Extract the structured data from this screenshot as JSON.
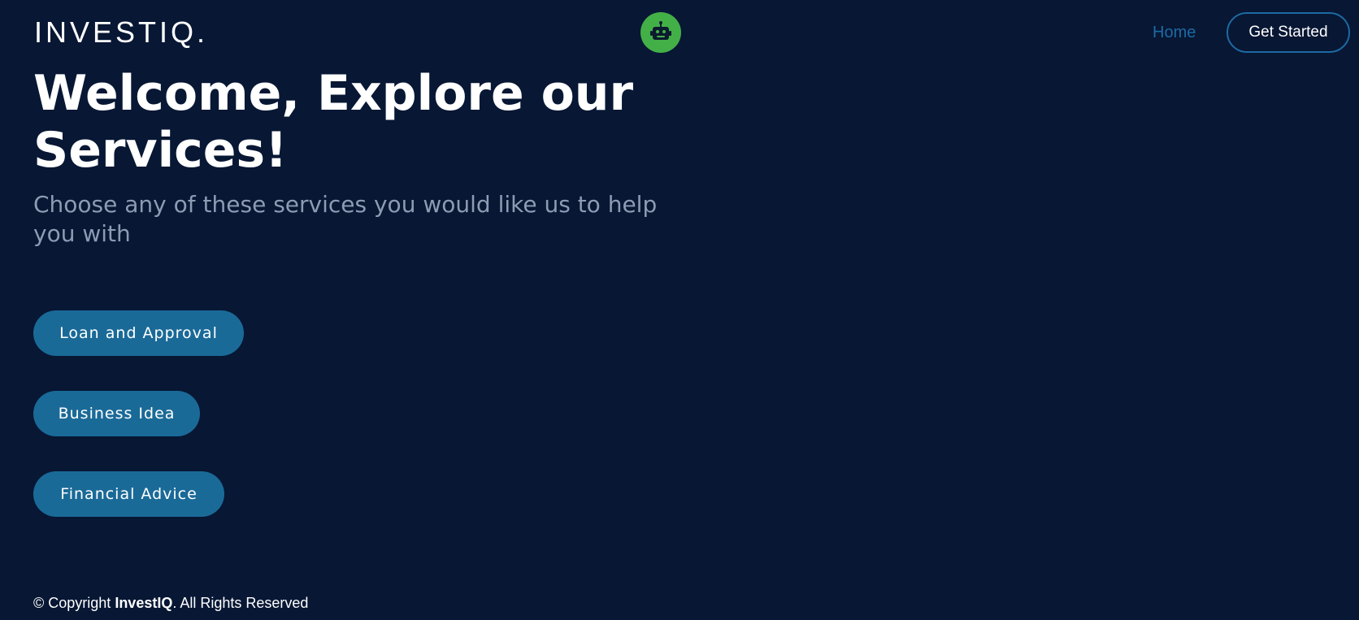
{
  "header": {
    "logo_text": "INVESTIQ",
    "logo_dot": ".",
    "bot_icon": "robot-icon",
    "nav_home": "Home",
    "get_started": "Get Started"
  },
  "hero": {
    "title": "Welcome, Explore our Services!",
    "subtitle": "Choose any of these services you would like us to help you with"
  },
  "services": [
    {
      "label": "Loan and Approval"
    },
    {
      "label": "Business Idea"
    },
    {
      "label": "Financial Advice"
    }
  ],
  "footer": {
    "prefix": "© Copyright ",
    "brand": "InvestIQ",
    "suffix": ". All Rights Reserved"
  },
  "colors": {
    "background": "#071734",
    "accent": "#1d6aa3",
    "button": "#1a6a98",
    "bot_bg": "#43b047",
    "subtitle": "#8d9bb3"
  }
}
